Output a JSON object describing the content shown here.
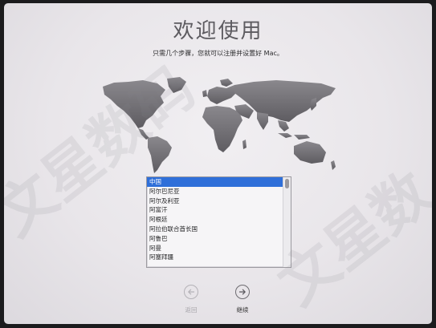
{
  "window": {
    "title": "欢迎使用",
    "subtitle": "只需几个步骤，您就可以注册并设置好 Mac。"
  },
  "country_list": {
    "items": [
      "中国",
      "阿尔巴尼亚",
      "阿尔及利亚",
      "阿富汗",
      "阿根廷",
      "阿拉伯联合酋长国",
      "阿鲁巴",
      "阿曼",
      "阿塞拜疆"
    ],
    "selected_index": 0
  },
  "nav": {
    "back_label": "返回",
    "continue_label": "继续",
    "back_enabled": false
  },
  "watermark": {
    "text": "文星数码"
  },
  "colors": {
    "selection": "#2f6fd9",
    "background": "#ebe8ec",
    "title": "#5d5b60",
    "map": "#6a686d"
  }
}
